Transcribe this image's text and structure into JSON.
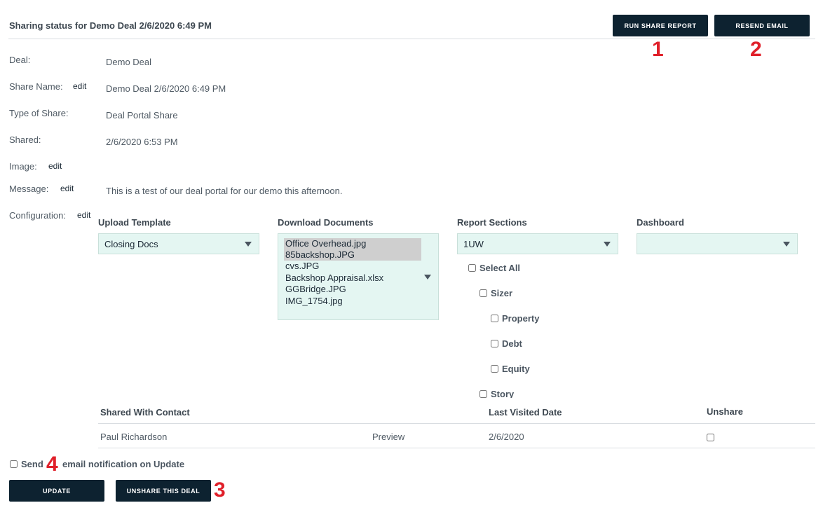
{
  "header": {
    "title": "Sharing status for Demo Deal 2/6/2020 6:49 PM",
    "run_share_report": "RUN SHARE REPORT",
    "resend_email": "RESEND EMAIL"
  },
  "markers": [
    "1",
    "2",
    "3",
    "4"
  ],
  "details": {
    "deal_label": "Deal:",
    "deal_value": "Demo Deal",
    "share_name_label": "Share Name:",
    "share_name_value": "Demo Deal 2/6/2020 6:49 PM",
    "type_label": "Type of Share:",
    "type_value": "Deal Portal Share",
    "shared_label": "Shared:",
    "shared_value": "2/6/2020 6:53 PM",
    "image_label": "Image:",
    "message_label": "Message:",
    "message_value": "This is a test of our deal portal for our demo this afternoon.",
    "configuration_label": "Configuration:",
    "edit": "edit"
  },
  "config": {
    "upload_template": {
      "heading": "Upload Template",
      "selected": "Closing Docs"
    },
    "download_documents": {
      "heading": "Download Documents",
      "options": [
        {
          "label": "Office Overhead.jpg",
          "selected": true
        },
        {
          "label": "85backshop.JPG",
          "selected": true
        },
        {
          "label": "cvs.JPG",
          "selected": false
        },
        {
          "label": "Backshop Appraisal.xlsx",
          "selected": false
        },
        {
          "label": "GGBridge.JPG",
          "selected": false
        },
        {
          "label": "IMG_1754.jpg",
          "selected": false
        }
      ]
    },
    "report_sections": {
      "heading": "Report Sections",
      "selected": "1UW",
      "checkboxes": [
        {
          "label": "Select All",
          "checked": false
        },
        {
          "label": "Sizer",
          "checked": false
        },
        {
          "label": "Property",
          "checked": false
        },
        {
          "label": "Debt",
          "checked": false
        },
        {
          "label": "Equity",
          "checked": false
        },
        {
          "label": "Story",
          "checked": false
        }
      ]
    },
    "dashboard": {
      "heading": "Dashboard",
      "selected": ""
    }
  },
  "contacts_table": {
    "headers": {
      "contact": "Shared With Contact",
      "last_visited": "Last Visited Date",
      "unshare": "Unshare"
    },
    "rows": [
      {
        "contact": "Paul Richardson",
        "preview": "Preview",
        "last_visited": "2/6/2020",
        "unshare": false
      }
    ]
  },
  "footer": {
    "send_label": "Send",
    "notification_label": "email notification on Update",
    "update": "UPDATE",
    "unshare_deal": "UNSHARE THIS DEAL"
  },
  "colors": {
    "button_bg": "#0d2230",
    "select_bg": "#e4f6f2",
    "marker": "#e0202a"
  }
}
